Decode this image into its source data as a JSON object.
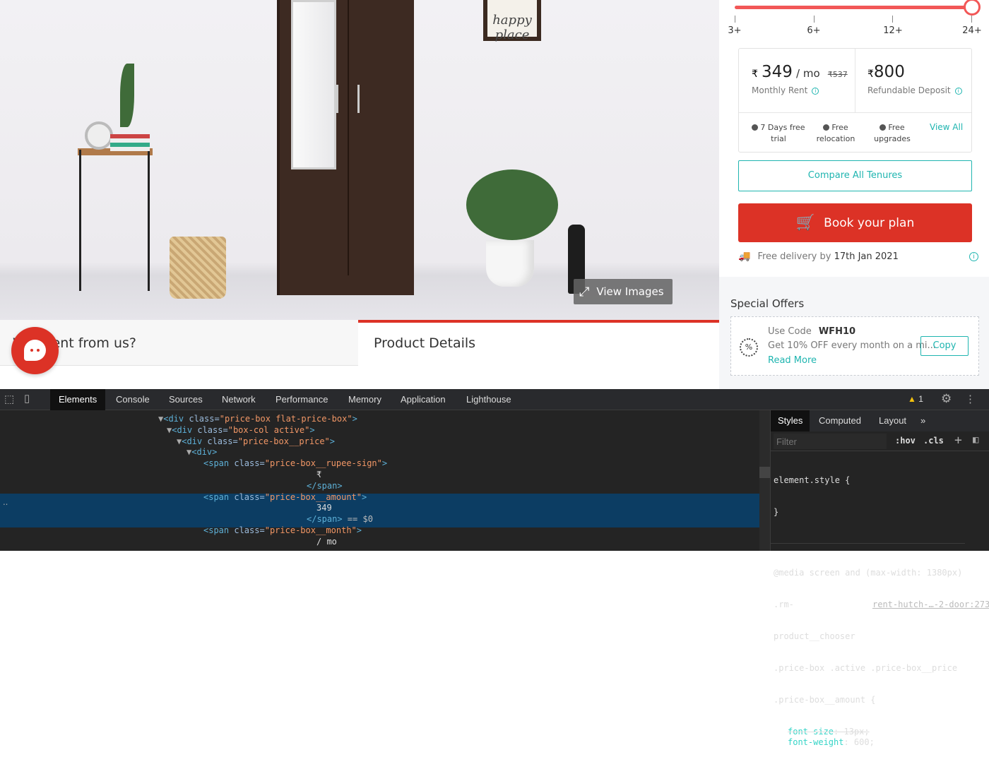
{
  "hero": {
    "frame_text": "happy place",
    "view_images": "View Images"
  },
  "tabs": [
    {
      "label": "Why rent from us?"
    },
    {
      "label": "Product Details"
    }
  ],
  "tenure": {
    "ticks": [
      "3+",
      "6+",
      "12+",
      "24+"
    ],
    "selected": "24+",
    "accent": "#f25757"
  },
  "price": {
    "rupee": "₹",
    "monthly": "349",
    "per": "/ mo",
    "original": "₹537",
    "monthly_label": "Monthly Rent",
    "deposit": "800",
    "deposit_label": "Refundable Deposit"
  },
  "features": [
    "7 Days free trial",
    "Free relocation",
    "Free upgrades"
  ],
  "view_all": "View All",
  "compare": "Compare All Tenures",
  "book": "Book your plan",
  "delivery": {
    "prefix": "Free delivery by",
    "date": "17th Jan 2021"
  },
  "offers": {
    "title": "Special Offers",
    "use_code": "Use Code",
    "code": "WFH10",
    "desc": "Get 10% OFF every month on a mi...",
    "read_more": "Read More",
    "copy": "Copy"
  },
  "devtools": {
    "tabs": [
      "Elements",
      "Console",
      "Sources",
      "Network",
      "Performance",
      "Memory",
      "Application",
      "Lighthouse"
    ],
    "warnings": "1",
    "dom": [
      {
        "tag": "<div ",
        "attr": "class=",
        "val": "\"price-box flat-price-box\"",
        "end": ">",
        "arrow": "▼"
      },
      {
        "tag": "<div ",
        "attr": "class=",
        "val": "\"box-col active\"",
        "end": ">",
        "arrow": "▼"
      },
      {
        "tag": "<div ",
        "attr": "class=",
        "val": "\"price-box__price\"",
        "end": ">",
        "arrow": "▼"
      },
      {
        "tag": "<div>",
        "attr": "",
        "val": "",
        "end": "",
        "arrow": "▼"
      },
      {
        "tag": "<span ",
        "attr": "class=",
        "val": "\"price-box__rupee-sign\"",
        "end": ">",
        "arrow": ""
      },
      {
        "text": "₹"
      },
      {
        "tag": "</span>",
        "attr": "",
        "val": "",
        "end": "",
        "arrow": ""
      },
      {
        "tag": "<span ",
        "attr": "class=",
        "val": "\"price-box__amount\"",
        "end": ">",
        "arrow": ""
      },
      {
        "text": "349"
      },
      {
        "tag": "</span>",
        "attr": "",
        "val": "",
        "end": " == $0",
        "arrow": ""
      },
      {
        "tag": "<span ",
        "attr": "class=",
        "val": "\"price-box__month\"",
        "end": ">",
        "arrow": ""
      },
      {
        "text": "/ mo"
      }
    ],
    "styles_tabs": [
      "Styles",
      "Computed",
      "Layout",
      "»"
    ],
    "filter_placeholder": "Filter",
    "hov": ":hov",
    "cls": ".cls",
    "rules": [
      "element.style {",
      "}",
      "@media screen and (max-width: 1380px)",
      ".rm-",
      "product__chooser",
      ".price-box .active .price-box__price",
      ".price-box__amount {"
    ],
    "source_link": "rent-hutch-…-2-door:273",
    "props": [
      {
        "name": "font-size",
        "value": "13px;",
        "struck": true
      },
      {
        "name": "font-weight",
        "value": "600;",
        "struck": false
      }
    ]
  }
}
